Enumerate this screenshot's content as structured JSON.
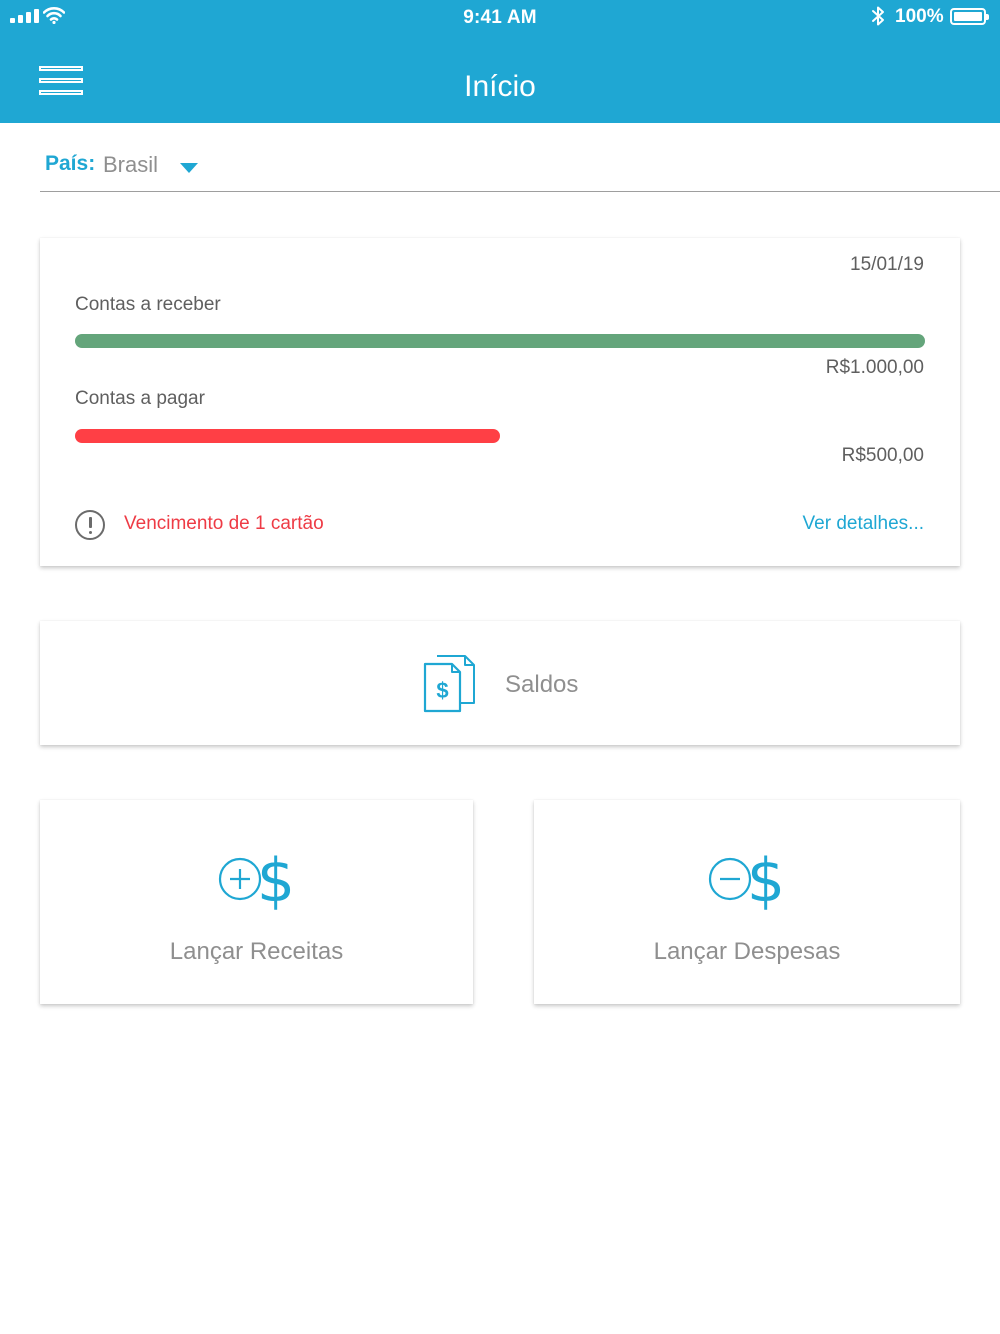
{
  "status_bar": {
    "time": "9:41 AM",
    "battery_text": "100%",
    "battery_level": 1.0
  },
  "header": {
    "title": "Início"
  },
  "country_select": {
    "label": "País:",
    "value": "Brasil"
  },
  "summary": {
    "date": "15/01/19",
    "receivable": {
      "label": "Contas a receber",
      "amount": "R$1.000,00",
      "fraction": 1.0,
      "color": "#64a57b"
    },
    "payable": {
      "label": "Contas a pagar",
      "amount": "R$500,00",
      "fraction": 0.5,
      "color": "#ff3f45"
    },
    "alert": {
      "icon": "alert-circle-icon",
      "text": "Vencimento de 1 cartão",
      "color": "#ee3b45"
    },
    "details_link": "Ver detalhes..."
  },
  "actions": {
    "saldos": {
      "label": "Saldos",
      "icon": "document-dollar-icon"
    },
    "receitas": {
      "label": "Lançar Receitas",
      "icon": "plus-dollar-icon"
    },
    "despesas": {
      "label": "Lançar Despesas",
      "icon": "minus-dollar-icon"
    }
  },
  "colors": {
    "accent": "#1fa7d3",
    "text": "#5f5f5f",
    "muted": "#8f8f8f"
  }
}
